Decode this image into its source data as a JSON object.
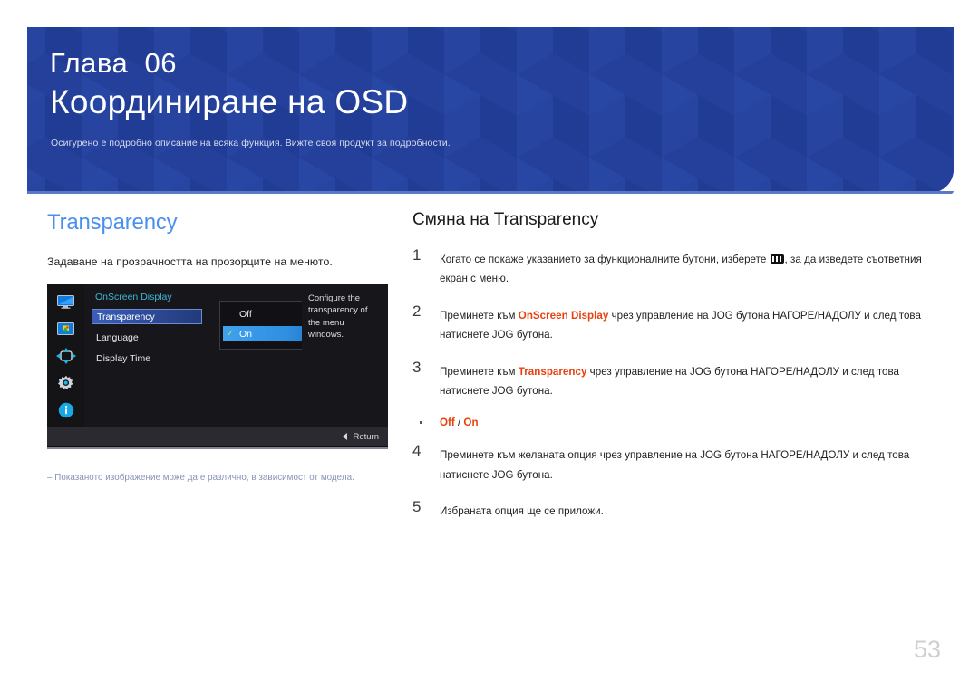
{
  "banner": {
    "chapter_label": "Глава",
    "chapter_number": "06",
    "title": "Координиране на OSD",
    "subtitle": "Осигурено е подробно описание на всяка функция. Вижте своя продукт за подробности.",
    "bg_color": "#24409a"
  },
  "left": {
    "section_title": "Transparency",
    "section_title_color": "#4a90f0",
    "description": "Задаване на прозрачността на прозорците на менюто.",
    "osd": {
      "heading": "OnScreen Display",
      "menu_items": [
        {
          "label": "Transparency",
          "selected": true
        },
        {
          "label": "Language",
          "selected": false
        },
        {
          "label": "Display Time",
          "selected": false
        }
      ],
      "popup_options": [
        {
          "label": "Off",
          "checked": false
        },
        {
          "label": "On",
          "checked": true
        }
      ],
      "description_panel": "Configure the transparency of the menu windows.",
      "footer_label": "Return",
      "rail_icons": [
        "monitor-icon",
        "picture-icon",
        "dpad-icon",
        "gear-icon",
        "info-icon"
      ]
    },
    "note": "–  Показаното изображение може да е различно, в зависимост от модела."
  },
  "right": {
    "title": "Смяна на Transparency",
    "steps": [
      {
        "number": "1",
        "text_before": "Когато се покаже указанието за функционалните бутони, изберете ",
        "has_menu_glyph": true,
        "text_after": ", за да изведете съответния екран с меню."
      },
      {
        "number": "2",
        "text_before": "Преминете към ",
        "highlight": "OnScreen Display",
        "text_after": " чрез управление на JOG бутона НАГОРЕ/НАДОЛУ и след това натиснете JOG бутона."
      },
      {
        "number": "3",
        "text_before": "Преминете към ",
        "highlight": "Transparency",
        "text_after": " чрез управление на JOG бутона НАГОРЕ/НАДОЛУ и след това натиснете JOG бутона."
      },
      {
        "number": "4",
        "text_before": "Преминете към желаната опция чрез управление на JOG бутона НАГОРЕ/НАДОЛУ и след това натиснете JOG бутона.",
        "highlight": "",
        "text_after": ""
      },
      {
        "number": "5",
        "text_before": "Избраната опция ще се приложи.",
        "highlight": "",
        "text_after": ""
      }
    ],
    "option_bullet": {
      "first": "Off",
      "separator": " / ",
      "second": "On"
    },
    "highlight_color": "#e8400c"
  },
  "footer": {
    "page_number": "53"
  }
}
